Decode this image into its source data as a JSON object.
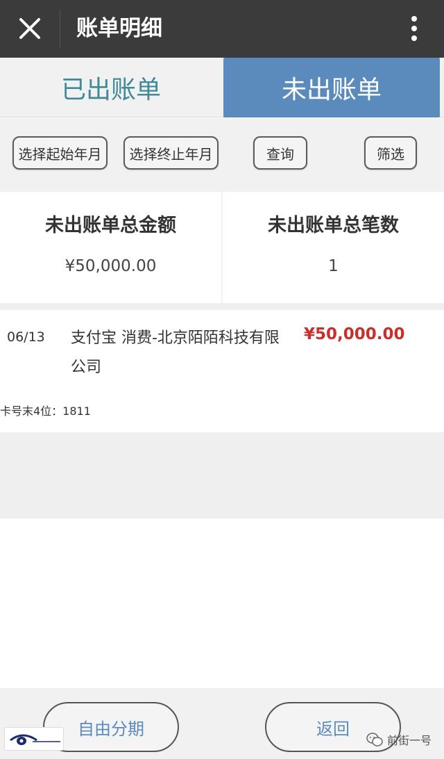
{
  "header": {
    "title": "账单明细",
    "close_icon": "close-icon",
    "more_icon": "more-vertical-icon"
  },
  "tabs": [
    {
      "label": "已出账单",
      "active": false
    },
    {
      "label": "未出账单",
      "active": true
    }
  ],
  "filters": {
    "start_month": "选择起始年月",
    "end_month": "选择终止年月",
    "query": "查询",
    "filter": "筛选"
  },
  "summary": {
    "total_amount_label": "未出账单总金额",
    "total_amount_value": "¥50,000.00",
    "total_count_label": "未出账单总笔数",
    "total_count_value": "1"
  },
  "records": [
    {
      "date": "06/13",
      "description": "支付宝 消费-北京陌陌科技有限公司",
      "amount": "¥50,000.00",
      "card_last4": "卡号末4位：1811"
    }
  ],
  "bottom": {
    "installment": "自由分期",
    "back": "返回"
  },
  "watermark": {
    "text": "前街一号",
    "icon": "wechat-icon"
  },
  "colors": {
    "header_bg": "#3b3b3b",
    "active_tab_bg": "#5b8bbd",
    "inactive_tab_text": "#3f8a98",
    "amount_red": "#c9302c",
    "button_text_blue": "#5b8bbd"
  }
}
